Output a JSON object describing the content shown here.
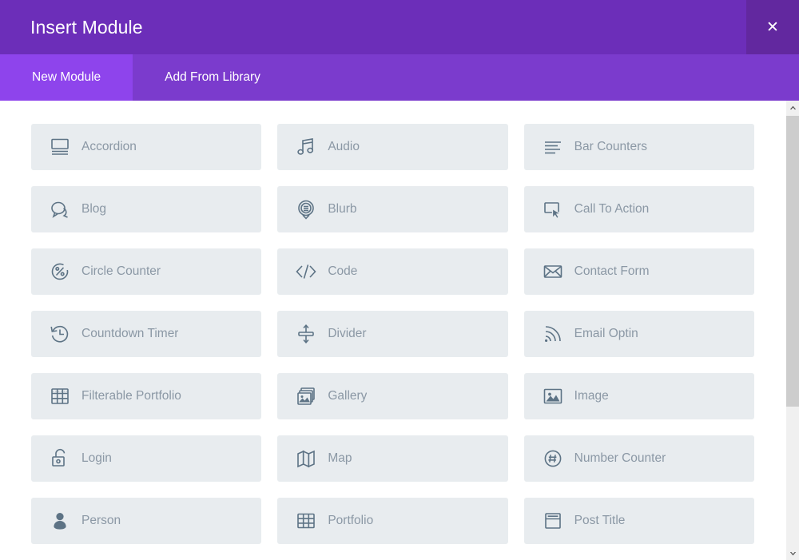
{
  "header": {
    "title": "Insert Module",
    "close_label": "✕",
    "close_icon": "close-icon",
    "bg_color": "#6c2eb9",
    "close_bg_color": "#62289f"
  },
  "tabs": [
    {
      "label": "New Module",
      "active": true
    },
    {
      "label": "Add From Library",
      "active": false
    }
  ],
  "tabs_style": {
    "bar_color": "#7b3bcd",
    "active_color": "#8e44ec",
    "text_color": "#ffffff"
  },
  "modules": [
    {
      "label": "Accordion",
      "icon": "accordion-icon"
    },
    {
      "label": "Audio",
      "icon": "audio-icon"
    },
    {
      "label": "Bar Counters",
      "icon": "bar-counters-icon"
    },
    {
      "label": "Blog",
      "icon": "blog-icon"
    },
    {
      "label": "Blurb",
      "icon": "blurb-icon"
    },
    {
      "label": "Call To Action",
      "icon": "call-to-action-icon"
    },
    {
      "label": "Circle Counter",
      "icon": "circle-counter-icon"
    },
    {
      "label": "Code",
      "icon": "code-icon"
    },
    {
      "label": "Contact Form",
      "icon": "contact-form-icon"
    },
    {
      "label": "Countdown Timer",
      "icon": "countdown-timer-icon"
    },
    {
      "label": "Divider",
      "icon": "divider-icon"
    },
    {
      "label": "Email Optin",
      "icon": "email-optin-icon"
    },
    {
      "label": "Filterable Portfolio",
      "icon": "filterable-portfolio-icon"
    },
    {
      "label": "Gallery",
      "icon": "gallery-icon"
    },
    {
      "label": "Image",
      "icon": "image-icon"
    },
    {
      "label": "Login",
      "icon": "login-icon"
    },
    {
      "label": "Map",
      "icon": "map-icon"
    },
    {
      "label": "Number Counter",
      "icon": "number-counter-icon"
    },
    {
      "label": "Person",
      "icon": "person-icon"
    },
    {
      "label": "Portfolio",
      "icon": "portfolio-icon"
    },
    {
      "label": "Post Title",
      "icon": "post-title-icon"
    }
  ],
  "tile_style": {
    "bg_color": "#e8ecef",
    "label_color": "#8b98a5",
    "icon_color": "#5d7385"
  },
  "scrollbar": {
    "track_color": "#f0f0f0",
    "thumb_color": "#cdcdcd",
    "up_icon": "chevron-up-icon",
    "down_icon": "chevron-down-icon"
  }
}
